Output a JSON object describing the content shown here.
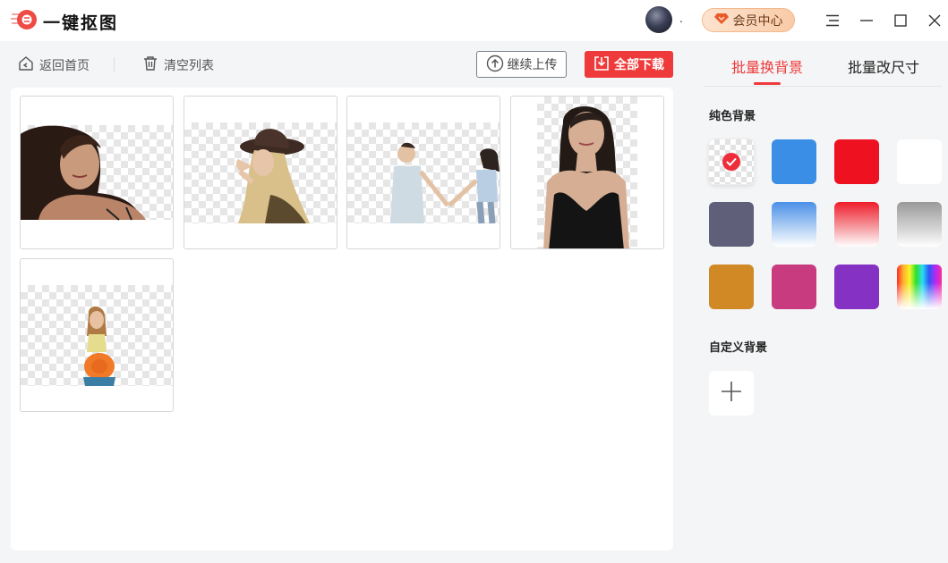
{
  "app": {
    "name": "一键抠图",
    "logo_icon": "scissors-logo-icon"
  },
  "titlebar": {
    "username": ".",
    "vip_label": "会员中心",
    "vip_icon": "diamond-icon",
    "menu_icon": "menu-icon",
    "minimize_icon": "minimize-icon",
    "maximize_icon": "maximize-icon",
    "close_icon": "close-icon"
  },
  "toolbar": {
    "back_label": "返回首页",
    "clear_label": "清空列表",
    "upload_label": "继续上传",
    "download_label": "全部下载"
  },
  "images": [
    {
      "name": "portrait-woman-dark-hair"
    },
    {
      "name": "woman-with-hat"
    },
    {
      "name": "two-women-holding-hands"
    },
    {
      "name": "woman-black-dress"
    },
    {
      "name": "woman-with-orange-hat"
    }
  ],
  "panel": {
    "tabs": [
      {
        "label": "批量换背景",
        "active": true
      },
      {
        "label": "批量改尺寸",
        "active": false
      }
    ],
    "solid_title": "纯色背景",
    "custom_title": "自定义背景",
    "selected_swatch": "transparent",
    "swatches": [
      {
        "name": "transparent",
        "color": "checker"
      },
      {
        "name": "blue",
        "color": "#3b8ee6"
      },
      {
        "name": "red",
        "color": "#ee1120"
      },
      {
        "name": "white",
        "color": "#ffffff"
      },
      {
        "name": "slate",
        "color": "#5f5f7a"
      },
      {
        "name": "blue-gradient",
        "color": "#4a90e8"
      },
      {
        "name": "red-gradient",
        "color": "#ee1c2a"
      },
      {
        "name": "gray-gradient",
        "color": "#9a9a9a"
      },
      {
        "name": "orange",
        "color": "#d08925"
      },
      {
        "name": "pink",
        "color": "#c93b7f"
      },
      {
        "name": "purple",
        "color": "#8431c4"
      },
      {
        "name": "rainbow",
        "color": "spectrum"
      }
    ]
  },
  "colors": {
    "accent": "#ee3a3a",
    "vip_bg": "#f9cba8"
  }
}
